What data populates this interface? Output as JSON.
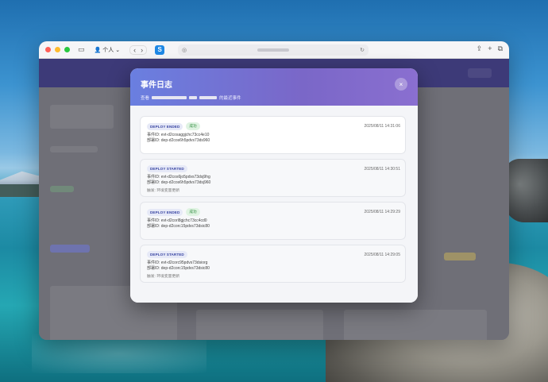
{
  "browser": {
    "profile_label": "个人",
    "url_text": "",
    "colors": {
      "accent": "#6a7fe0"
    }
  },
  "modal": {
    "title": "事件日志",
    "subtitle_prefix": "查看",
    "subtitle_suffix": "的最近事件",
    "close_label": "×",
    "events": [
      {
        "type": "DEPLOY ENDED",
        "status": "成功",
        "timestamp": "2025/08/11 14:31:06",
        "event_id": "事件ID: evt-d2cosaggjchc73cc4e10",
        "deploy_id": "部署ID: dep-d2cos6h5pdvs73ds960",
        "description": ""
      },
      {
        "type": "DEPLOY STARTED",
        "status": "",
        "timestamp": "2025/08/11 14:30:51",
        "event_id": "事件ID: evt-d2cos6jo5pdvs73dsj9hg",
        "deploy_id": "部署ID: dep-d2cos6h5pdvs73dsj960",
        "description": "触发: 环境变量更新"
      },
      {
        "type": "DEPLOY ENDED",
        "status": "成功",
        "timestamp": "2025/08/11 14:29:29",
        "event_id": "事件ID: evt-d2corl8gjchc73cc4cd0",
        "deploy_id": "部署ID: dep-d2corc15pdvs73dsic80",
        "description": ""
      },
      {
        "type": "DEPLOY STARTED",
        "status": "",
        "timestamp": "2025/08/11 14:29:05",
        "event_id": "事件ID: evt-d2corc95pdvs73dsiorg",
        "deploy_id": "部署ID: dep-d2corc15pdvs73dsic80",
        "description": "触发: 环境变量更新"
      }
    ]
  }
}
